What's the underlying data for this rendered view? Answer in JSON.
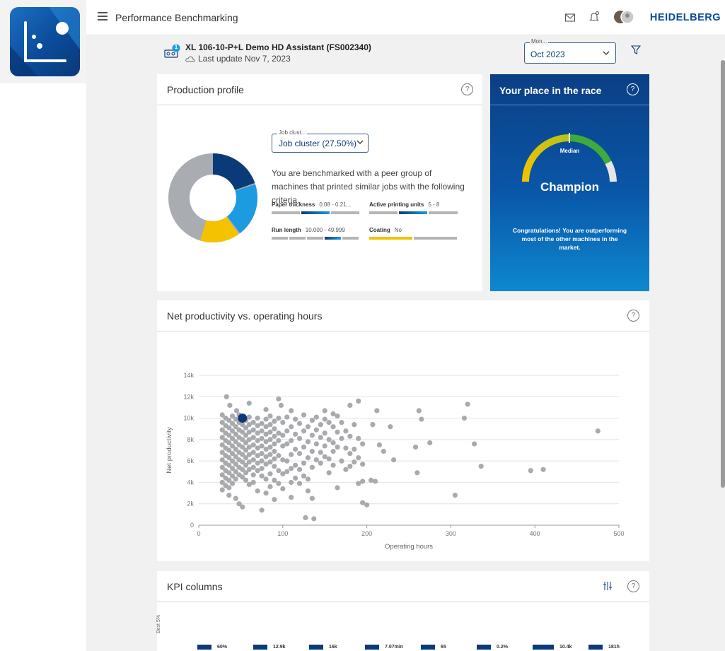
{
  "app": {
    "title": "Performance Benchmarking",
    "brand": "HEIDELBERG"
  },
  "machine": {
    "name": "XL 106-10-P+L Demo HD Assistant (FS002340)",
    "last_update": "Last update Nov 7, 2023",
    "badge": "1"
  },
  "month_filter": {
    "label": "Mon...",
    "value": "Oct 2023"
  },
  "production_profile": {
    "title": "Production profile",
    "help": "?",
    "cluster_label": "Job clust...",
    "cluster_value": "Job cluster (27.50%)",
    "description": "You are benchmarked with a peer group of machines that printed similar jobs with the following criteria.",
    "criteria": [
      {
        "name": "Paper thickness",
        "value": "0.08 - 0.21..."
      },
      {
        "name": "Active printing units",
        "value": "5 - 8"
      },
      {
        "name": "Run length",
        "value": "10.000 - 49.999"
      },
      {
        "name": "Coating",
        "value": "No"
      }
    ],
    "donut": {
      "colors": [
        "#0b3a78",
        "#1d9be0",
        "#f5c200",
        "#a9acb0"
      ]
    }
  },
  "race": {
    "title": "Your place in the race",
    "help": "?",
    "median_label": "Median",
    "rank": "Champion",
    "message": "Congratulations! You are outperforming most of the other machines in the market."
  },
  "scatter_card": {
    "title": "Net productivity vs. operating hours",
    "help": "?"
  },
  "chart_data": {
    "type": "scatter",
    "xlabel": "Operating hours",
    "ylabel": "Net productivity",
    "xlim": [
      0,
      500
    ],
    "ylim": [
      0,
      14000
    ],
    "x_ticks": [
      "0",
      "100",
      "200",
      "300",
      "400",
      "500"
    ],
    "y_ticks": [
      "0",
      "2k",
      "4k",
      "6k",
      "8k",
      "10k",
      "12k",
      "14k"
    ],
    "highlight": {
      "x": 52,
      "y": 10000,
      "color": "#0b3a78"
    },
    "series": [
      {
        "color": "#a8aaad",
        "points": [
          [
            33,
            12000
          ],
          [
            37,
            11200
          ],
          [
            45,
            10700
          ],
          [
            60,
            11400
          ],
          [
            95,
            11800
          ],
          [
            98,
            11200
          ],
          [
            80,
            10800
          ],
          [
            110,
            10700
          ],
          [
            150,
            10700
          ],
          [
            160,
            10400
          ],
          [
            190,
            11600
          ],
          [
            180,
            11200
          ],
          [
            212,
            10700
          ],
          [
            262,
            10700
          ],
          [
            320,
            11300
          ],
          [
            316,
            10000
          ],
          [
            265,
            9900
          ],
          [
            228,
            9200
          ],
          [
            207,
            9400
          ],
          [
            28,
            10300
          ],
          [
            28,
            9600
          ],
          [
            28,
            8900
          ],
          [
            28,
            8200
          ],
          [
            28,
            7500
          ],
          [
            28,
            6800
          ],
          [
            28,
            6100
          ],
          [
            28,
            5400
          ],
          [
            28,
            4700
          ],
          [
            28,
            4000
          ],
          [
            28,
            3300
          ],
          [
            32,
            10000
          ],
          [
            32,
            9300
          ],
          [
            32,
            8600
          ],
          [
            32,
            7900
          ],
          [
            32,
            7200
          ],
          [
            32,
            6500
          ],
          [
            32,
            5800
          ],
          [
            32,
            5100
          ],
          [
            32,
            4400
          ],
          [
            32,
            3700
          ],
          [
            36,
            9800
          ],
          [
            36,
            9100
          ],
          [
            36,
            8400
          ],
          [
            36,
            7700
          ],
          [
            36,
            7000
          ],
          [
            36,
            6300
          ],
          [
            36,
            5600
          ],
          [
            36,
            4900
          ],
          [
            36,
            4200
          ],
          [
            36,
            3500
          ],
          [
            36,
            2800
          ],
          [
            40,
            10200
          ],
          [
            40,
            9500
          ],
          [
            40,
            8800
          ],
          [
            40,
            8100
          ],
          [
            40,
            7400
          ],
          [
            40,
            6700
          ],
          [
            40,
            6000
          ],
          [
            40,
            5300
          ],
          [
            40,
            4600
          ],
          [
            40,
            3900
          ],
          [
            44,
            9900
          ],
          [
            44,
            9200
          ],
          [
            44,
            8500
          ],
          [
            44,
            7800
          ],
          [
            44,
            7100
          ],
          [
            44,
            6400
          ],
          [
            44,
            5700
          ],
          [
            44,
            5000
          ],
          [
            44,
            4300
          ],
          [
            44,
            2500
          ],
          [
            48,
            10300
          ],
          [
            48,
            9600
          ],
          [
            48,
            8900
          ],
          [
            48,
            8200
          ],
          [
            48,
            7500
          ],
          [
            48,
            6800
          ],
          [
            48,
            6100
          ],
          [
            48,
            5400
          ],
          [
            48,
            4700
          ],
          [
            48,
            2000
          ],
          [
            52,
            9400
          ],
          [
            52,
            8700
          ],
          [
            52,
            8000
          ],
          [
            52,
            7300
          ],
          [
            52,
            6600
          ],
          [
            52,
            5900
          ],
          [
            52,
            5200
          ],
          [
            52,
            4500
          ],
          [
            52,
            1700
          ],
          [
            56,
            9800
          ],
          [
            56,
            9100
          ],
          [
            56,
            8400
          ],
          [
            56,
            7700
          ],
          [
            56,
            7000
          ],
          [
            56,
            6300
          ],
          [
            56,
            5600
          ],
          [
            56,
            4900
          ],
          [
            56,
            4200
          ],
          [
            60,
            10100
          ],
          [
            60,
            9400
          ],
          [
            60,
            8700
          ],
          [
            60,
            8000
          ],
          [
            60,
            7300
          ],
          [
            60,
            6600
          ],
          [
            60,
            5900
          ],
          [
            60,
            5200
          ],
          [
            60,
            3800
          ],
          [
            65,
            9600
          ],
          [
            65,
            8900
          ],
          [
            65,
            8200
          ],
          [
            65,
            7500
          ],
          [
            65,
            6800
          ],
          [
            65,
            6100
          ],
          [
            65,
            5400
          ],
          [
            65,
            4700
          ],
          [
            65,
            4000
          ],
          [
            70,
            10000
          ],
          [
            70,
            9300
          ],
          [
            70,
            8600
          ],
          [
            70,
            7900
          ],
          [
            70,
            7200
          ],
          [
            70,
            6500
          ],
          [
            70,
            5800
          ],
          [
            70,
            5100
          ],
          [
            70,
            3200
          ],
          [
            75,
            9500
          ],
          [
            75,
            8800
          ],
          [
            75,
            8100
          ],
          [
            75,
            7400
          ],
          [
            75,
            6700
          ],
          [
            75,
            6000
          ],
          [
            75,
            5300
          ],
          [
            75,
            4600
          ],
          [
            75,
            1400
          ],
          [
            80,
            9900
          ],
          [
            80,
            9200
          ],
          [
            80,
            8500
          ],
          [
            80,
            7800
          ],
          [
            80,
            7100
          ],
          [
            80,
            6400
          ],
          [
            80,
            5700
          ],
          [
            80,
            4300
          ],
          [
            80,
            3000
          ],
          [
            85,
            10200
          ],
          [
            85,
            9400
          ],
          [
            85,
            8700
          ],
          [
            85,
            8000
          ],
          [
            85,
            7300
          ],
          [
            85,
            6600
          ],
          [
            85,
            5900
          ],
          [
            85,
            4800
          ],
          [
            85,
            3600
          ],
          [
            90,
            9700
          ],
          [
            90,
            9000
          ],
          [
            90,
            8300
          ],
          [
            90,
            7600
          ],
          [
            90,
            6900
          ],
          [
            90,
            6200
          ],
          [
            90,
            5500
          ],
          [
            90,
            4200
          ],
          [
            90,
            2400
          ],
          [
            95,
            10000
          ],
          [
            95,
            8600
          ],
          [
            95,
            7900
          ],
          [
            95,
            6500
          ],
          [
            95,
            5100
          ],
          [
            95,
            3900
          ],
          [
            100,
            9600
          ],
          [
            100,
            8400
          ],
          [
            100,
            7400
          ],
          [
            100,
            6100
          ],
          [
            100,
            4800
          ],
          [
            100,
            3400
          ],
          [
            105,
            10100
          ],
          [
            105,
            8800
          ],
          [
            105,
            7600
          ],
          [
            105,
            6000
          ],
          [
            105,
            5000
          ],
          [
            110,
            9200
          ],
          [
            110,
            7900
          ],
          [
            110,
            6600
          ],
          [
            110,
            5300
          ],
          [
            110,
            4000
          ],
          [
            110,
            2600
          ],
          [
            115,
            9900
          ],
          [
            115,
            8500
          ],
          [
            115,
            7100
          ],
          [
            115,
            5600
          ],
          [
            115,
            4400
          ],
          [
            120,
            9500
          ],
          [
            120,
            8100
          ],
          [
            120,
            6700
          ],
          [
            120,
            5200
          ],
          [
            120,
            3900
          ],
          [
            125,
            10300
          ],
          [
            125,
            8800
          ],
          [
            125,
            7300
          ],
          [
            125,
            5800
          ],
          [
            125,
            4600
          ],
          [
            130,
            9200
          ],
          [
            130,
            7800
          ],
          [
            130,
            6300
          ],
          [
            130,
            4300
          ],
          [
            130,
            3200
          ],
          [
            127,
            700
          ],
          [
            137,
            600
          ],
          [
            135,
            9800
          ],
          [
            135,
            8400
          ],
          [
            135,
            6900
          ],
          [
            135,
            5400
          ],
          [
            135,
            2500
          ],
          [
            140,
            10100
          ],
          [
            140,
            8900
          ],
          [
            140,
            7600
          ],
          [
            140,
            6100
          ],
          [
            145,
            9400
          ],
          [
            145,
            8200
          ],
          [
            145,
            6800
          ],
          [
            145,
            5800
          ],
          [
            150,
            9900
          ],
          [
            150,
            8600
          ],
          [
            150,
            7400
          ],
          [
            150,
            6400
          ],
          [
            155,
            9600
          ],
          [
            155,
            8000
          ],
          [
            155,
            6200
          ],
          [
            155,
            4900
          ],
          [
            160,
            9200
          ],
          [
            160,
            7700
          ],
          [
            160,
            6900
          ],
          [
            160,
            5600
          ],
          [
            165,
            10200
          ],
          [
            165,
            8700
          ],
          [
            165,
            7300
          ],
          [
            165,
            3500
          ],
          [
            170,
            9600
          ],
          [
            170,
            8100
          ],
          [
            170,
            6000
          ],
          [
            175,
            8800
          ],
          [
            175,
            7200
          ],
          [
            175,
            5200
          ],
          [
            180,
            8300
          ],
          [
            180,
            6700
          ],
          [
            180,
            5500
          ],
          [
            185,
            9400
          ],
          [
            185,
            7100
          ],
          [
            185,
            5900
          ],
          [
            190,
            8100
          ],
          [
            190,
            6300
          ],
          [
            190,
            3900
          ],
          [
            195,
            7600
          ],
          [
            195,
            5700
          ],
          [
            195,
            4100
          ],
          [
            195,
            2100
          ],
          [
            200,
            1900
          ],
          [
            205,
            4200
          ],
          [
            210,
            4100
          ],
          [
            215,
            7500
          ],
          [
            220,
            6900
          ],
          [
            232,
            6100
          ],
          [
            258,
            7300
          ],
          [
            260,
            4900
          ],
          [
            275,
            7700
          ],
          [
            305,
            2800
          ],
          [
            328,
            7600
          ],
          [
            336,
            5500
          ],
          [
            395,
            5100
          ],
          [
            410,
            5200
          ],
          [
            475,
            8800
          ]
        ]
      }
    ]
  },
  "kpi_card": {
    "title": "KPI columns",
    "help": "?",
    "row_label": "Best 5%",
    "values": [
      "60%",
      "12.9k",
      "16k",
      "7.07min",
      "65",
      "0.2%",
      "10.4k",
      "181h"
    ]
  }
}
